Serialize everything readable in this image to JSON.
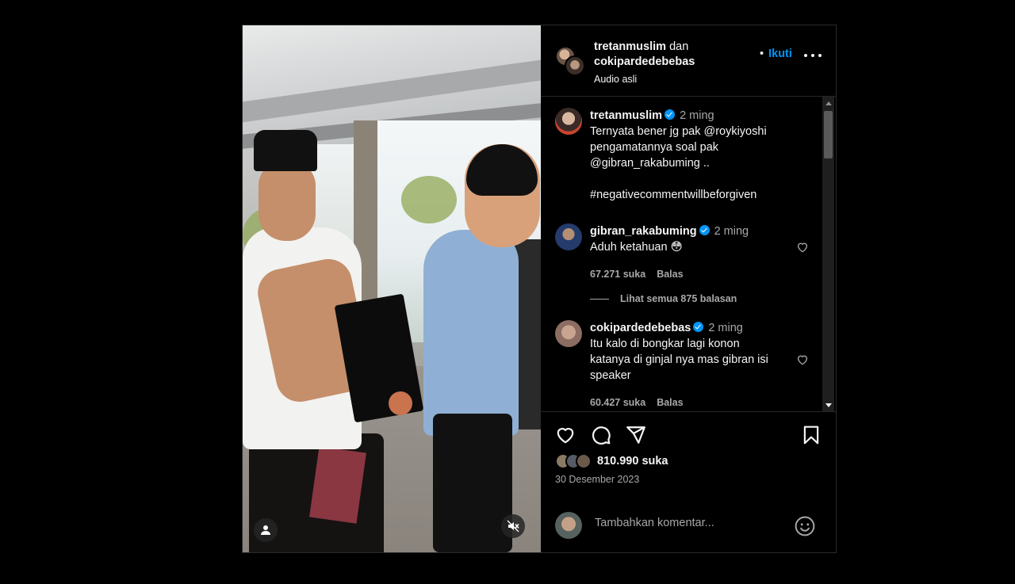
{
  "header": {
    "user1": "tretanmuslim",
    "conjunction": "dan",
    "user2": "cokipardedebebas",
    "audio": "Audio asli",
    "follow_label": "Ikuti",
    "follow_dot": "•"
  },
  "caption": {
    "username": "tretanmuslim",
    "time": "2 ming",
    "line1": "Ternyata bener jg pak @roykiyoshi",
    "line2": "pengamatannya soal pak",
    "line3": "@gibran_rakabuming ..",
    "line4": "#negativecommentwillbeforgiven"
  },
  "comments": [
    {
      "username": "gibran_rakabuming",
      "time": "2 ming",
      "text": "Aduh ketahuan 😳",
      "likes": "67.271 suka",
      "reply": "Balas"
    },
    {
      "username": "cokipardedebebas",
      "time": "2 ming",
      "line1": "Itu kalo di bongkar lagi konon",
      "line2": "katanya di ginjal nya mas gibran isi",
      "line3": "speaker",
      "likes": "60.427 suka",
      "reply": "Balas"
    }
  ],
  "view_replies": "Lihat semua 875 balasan",
  "likes_total": "810.990 suka",
  "date": "30 Desember 2023",
  "add_comment_placeholder": "Tambahkan komentar...",
  "colors": {
    "accent": "#0095f6",
    "muted": "#a8a8a8",
    "background": "#000000",
    "text": "#f5f5f5"
  },
  "icons": [
    "heart-icon",
    "comment-icon",
    "share-icon",
    "bookmark-icon",
    "emoji-icon",
    "mute-icon",
    "tag-user-icon",
    "more-icon",
    "verified-icon"
  ]
}
